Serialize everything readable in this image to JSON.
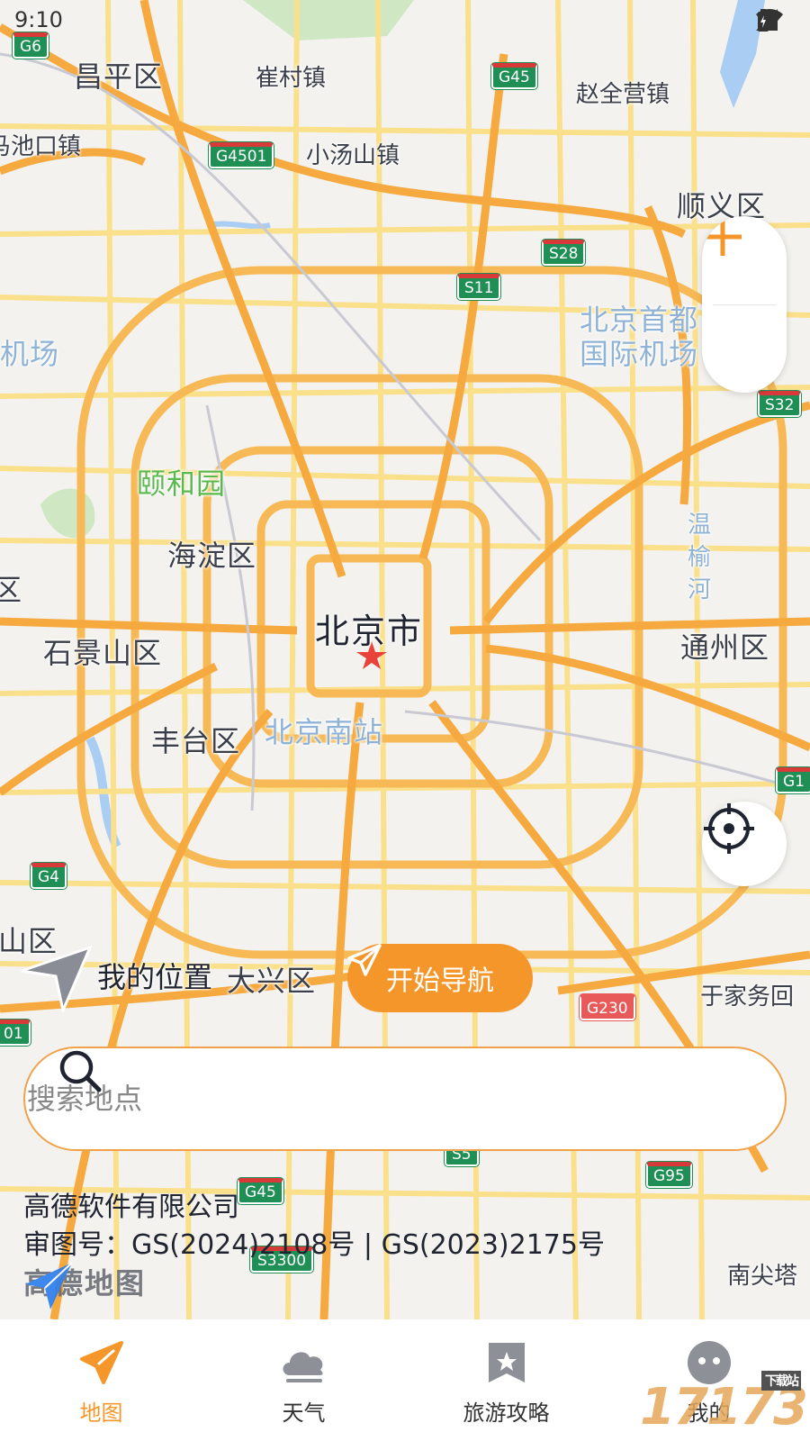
{
  "status_bar": {
    "time": "9:10"
  },
  "map": {
    "city_label": "北京市",
    "district_labels": [
      "昌平区",
      "顺义区",
      "海淀区",
      "石景山区",
      "丰台区",
      "通州区",
      "大兴区",
      "区",
      "山区"
    ],
    "town_labels": [
      "崔村镇",
      "赵全营镇",
      "小汤山镇",
      "马池口镇",
      "于家务回",
      "南尖塔"
    ],
    "poi_labels": [
      "北京首都",
      "国际机场",
      "北京南站",
      "机场",
      "温",
      "榆",
      "河"
    ],
    "park_labels": [
      "颐和园"
    ],
    "road_shields": [
      "G6",
      "G45",
      "G4501",
      "S28",
      "S11",
      "S32",
      "G1",
      "G4",
      "G230",
      "G95",
      "G45",
      "S3300",
      "S5",
      "01"
    ],
    "my_location_label": "我的位置",
    "start_navigation_label": "开始导航",
    "zoom_in_label": "+",
    "zoom_out_label": "−"
  },
  "search": {
    "placeholder": "搜索地点"
  },
  "copyright": {
    "company": "高德软件有限公司",
    "approval": "审图号：GS(2024)2108号 | GS(2023)2175号",
    "logo_text": "高德地图"
  },
  "tabs": [
    {
      "label": "地图",
      "icon": "navigation-arrow-icon",
      "active": true
    },
    {
      "label": "天气",
      "icon": "cloud-icon",
      "active": false
    },
    {
      "label": "旅游攻略",
      "icon": "star-bookmark-icon",
      "active": false
    },
    {
      "label": "我的",
      "icon": "avatar-face-icon",
      "active": false
    }
  ],
  "watermark": {
    "text": "17173",
    "badge": "下载站"
  },
  "colors": {
    "accent": "#f5962b",
    "road_major": "#f7b955",
    "road_minor": "#fbe08c",
    "map_bg": "#f3f2ee"
  }
}
